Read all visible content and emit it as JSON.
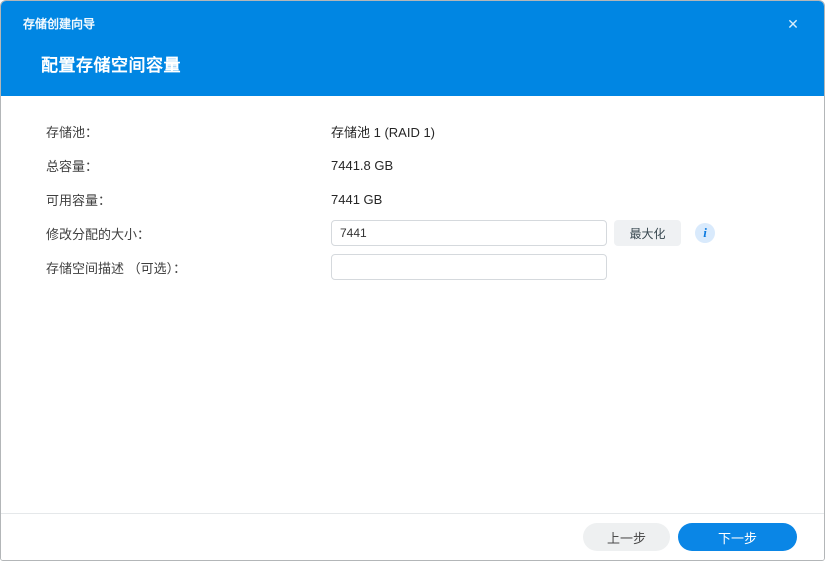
{
  "dialog": {
    "title": "存储创建向导",
    "step_title": "配置存储空间容量",
    "close_icon": "✕"
  },
  "form": {
    "rows": [
      {
        "label": "存储池：",
        "value": "存储池 1 (RAID 1)"
      },
      {
        "label": "总容量：",
        "value": "7441.8 GB"
      },
      {
        "label": "可用容量：",
        "value": "7441 GB"
      }
    ],
    "size_row": {
      "label": "修改分配的大小：",
      "value": "7441",
      "max_button_label": "最大化",
      "info_icon": "i"
    },
    "desc_row": {
      "label": "存储空间描述 （可选）：",
      "value": "",
      "placeholder": ""
    }
  },
  "footer": {
    "back_label": "上一步",
    "next_label": "下一步"
  },
  "colors": {
    "header_blue": "#0086e3",
    "accent_blue": "#0a86e6",
    "button_gray": "#eef0f1"
  }
}
